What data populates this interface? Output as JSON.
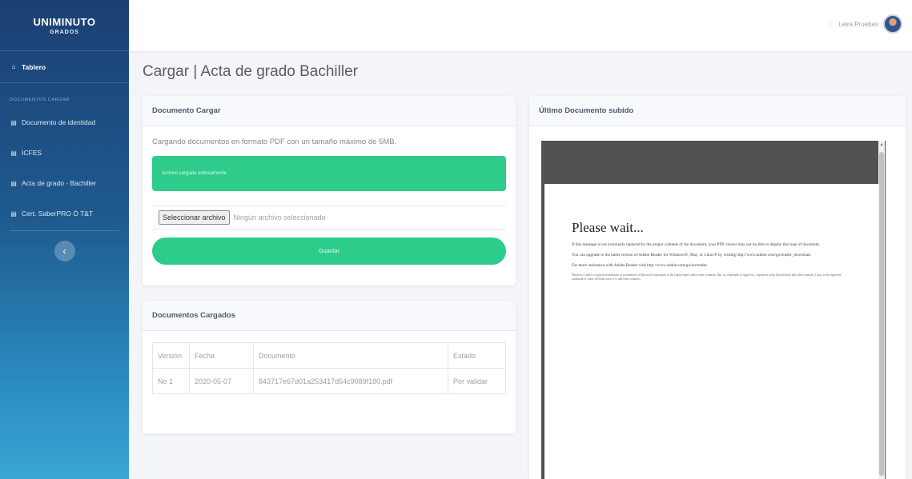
{
  "sidebar": {
    "brand_line1": "UNIMINUTO",
    "brand_line2": "GRADOS",
    "dashboard_label": "Tablero",
    "section_heading": "Documentos cargar",
    "items": [
      {
        "label": "Documento de identidad"
      },
      {
        "label": "ICFES"
      },
      {
        "label": "Acta de grado - Bachiller"
      },
      {
        "label": "Cert. SaberPRO Ó T&T"
      }
    ],
    "toggle_icon": "chevron-left-icon"
  },
  "topbar": {
    "user_name": "Leira Pruebas"
  },
  "page": {
    "title": "Cargar | Acta de grado Bachiller"
  },
  "upload": {
    "header": "Documento Cargar",
    "text": "Cargando documentos en formato PDF con un tamaño máximo de 5MB.",
    "alert": "Archivo cargado exitosamente",
    "file_button": "Seleccionar archivo",
    "file_status": "Ningún archivo seleccionado",
    "save_label": "Guardar"
  },
  "docs": {
    "header": "Documentos Cargados",
    "columns": [
      "Versión",
      "Fecha",
      "Documento",
      "Estado"
    ],
    "rows": [
      {
        "version": "No 1",
        "fecha": "2020-05-07",
        "documento": "843717e67d01a253417d54c9089f180.pdf",
        "estado": "Por validar"
      }
    ]
  },
  "preview": {
    "header": "Último Documento subido",
    "pdf_title": "Please wait...",
    "pdf_p1": "If this message is not eventually replaced by the proper contents of the document, your PDF viewer may not be able to display this type of document.",
    "pdf_p2": "You can upgrade to the latest version of Adobe Reader for Windows®, Mac, or Linux® by visiting http://www.adobe.com/go/reader_download.",
    "pdf_p3": "For more assistance with Adobe Reader visit http://www.adobe.com/go/acrreader.",
    "pdf_fine": "Windows is either a registered trademark or a trademark of Microsoft Corporation in the United States and/or other countries. Mac is a trademark of Apple Inc., registered in the United States and other countries. Linux is the registered trademark of Linus Torvalds in the U.S. and other countries."
  },
  "colors": {
    "sidebar_top": "#1c3f73",
    "sidebar_bottom": "#3aa6d4",
    "accent_green": "#2ecc8a",
    "viewer_bg": "#525252"
  }
}
